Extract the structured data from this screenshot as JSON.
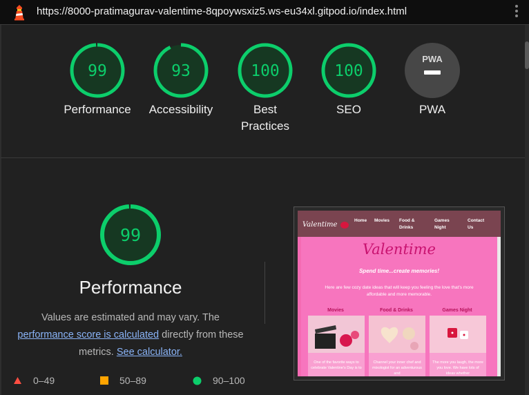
{
  "browser": {
    "url": "https://8000-pratimagurav-valentime-8qpoywsxiz5.ws-eu34xl.gitpod.io/index.html"
  },
  "gauges": [
    {
      "score": "99",
      "value": 99,
      "label": "Performance"
    },
    {
      "score": "93",
      "value": 93,
      "label": "Accessibility"
    },
    {
      "score": "100",
      "value": 100,
      "label_line1": "Best",
      "label_line2": "Practices"
    },
    {
      "score": "100",
      "value": 100,
      "label": "SEO"
    },
    {
      "badge": "PWA",
      "label": "PWA"
    }
  ],
  "performance": {
    "score": "99",
    "value": 99,
    "title": "Performance",
    "desc_1": "Values are estimated and may vary. The",
    "link_1": "performance score is calculated",
    "desc_2": " directly from these",
    "desc_3": "metrics. ",
    "link_2": "See calculator.",
    "legend": [
      {
        "range": "0–49",
        "shape": "triangle",
        "color": "#ff4e42"
      },
      {
        "range": "50–89",
        "shape": "square",
        "color": "#ffa400"
      },
      {
        "range": "90–100",
        "shape": "circle",
        "color": "#0cce6b"
      }
    ]
  },
  "screenshot": {
    "logo": "Valentime",
    "nav": [
      "Home",
      "Movies",
      "Food &",
      "Drinks",
      "Games",
      "Night",
      "Contact",
      "Us"
    ],
    "title": "Valentime",
    "subtitle": "Spend time...create memories!",
    "intro": "Here are few cozy date ideas that will keep you feeling the love that's more affordable and more memorable.",
    "cards": [
      {
        "heading": "Movies",
        "text": "One of the favorite ways to celebrate Valentine's Day is to"
      },
      {
        "heading": "Food & Drinks",
        "text": "Channel your inner chef and mixologist for an adventurous and"
      },
      {
        "heading": "Games Night",
        "text": "The more you laugh, the more you love. We have lots of ideas whether"
      }
    ]
  },
  "colors": {
    "pass": "#0cce6b",
    "average": "#ffa400",
    "fail": "#ff4e42"
  }
}
